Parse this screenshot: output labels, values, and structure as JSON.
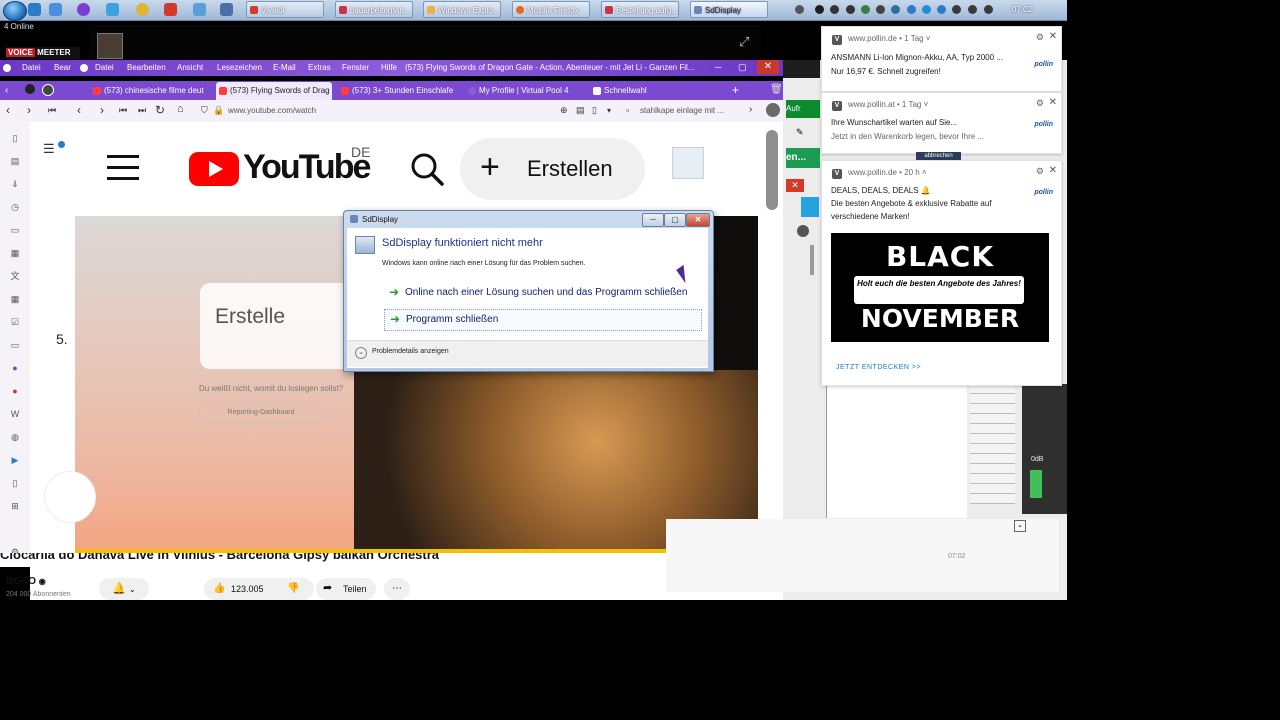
{
  "taskbar": {
    "tasks": [
      {
        "label": "Vivaldi",
        "color": "#d33a2c"
      },
      {
        "label": "bauarbeiterhan...",
        "color": "#c9334b"
      },
      {
        "label": "Windows Explo...",
        "color": "#e8b44a"
      },
      {
        "label": "Mozilla Firefox",
        "color": "#e66a1a"
      },
      {
        "label": "Bestellung aufg...",
        "color": "#c9334b"
      },
      {
        "label": "SdDisplay",
        "color": "#6b87b6"
      }
    ],
    "clock": "07:02"
  },
  "voicemeeter": {
    "online_label": "4 Online",
    "brand_a": "VOICE",
    "brand_b": "MEETER"
  },
  "vivaldi": {
    "menu": [
      "Datei",
      "Bear",
      "Datei",
      "Bearbeiten",
      "Ansicht",
      "Lesezeichen",
      "E-Mail",
      "Extras",
      "Fenster",
      "Hilfe"
    ],
    "window_title": "(573) Flying Swords of Dragon Gate - Action, Abenteuer - mit Jet Li - Ganzen Fil...",
    "tabs": [
      {
        "label": "(573) chinesische filme deut",
        "color": "#ff3b3b"
      },
      {
        "label": "(573) Flying Swords of Drag",
        "color": "#ff3b3b",
        "active": true
      },
      {
        "label": "(573) 3+ Stunden Einschlafe",
        "color": "#ff3b3b"
      },
      {
        "label": "My Profile | Virtual Pool 4",
        "color": "#8a5ad8"
      },
      {
        "label": "Schnellwahl",
        "color": "#ffffff"
      }
    ],
    "url": "www.youtube.com/watch",
    "search_text": "stahlkape einlage mit ..."
  },
  "youtube": {
    "logo_text": "YouTube",
    "country": "DE",
    "create_label": "Erstellen",
    "video_card_text": "Erstelle",
    "video_sub_text": "Du weißt nicht, womit du loslegen sollst?",
    "video_pill": "Reporting-Dashboard",
    "side_number": "5.",
    "video_title": "Ciocarlia do Danava Live in Vilnius - Barcelona Gipsy balkan Orchestra",
    "channel_name": "BGKO",
    "channel_subs": "204 000 Abonnenten",
    "like_count": "123.005",
    "share_label": "Teilen"
  },
  "error_dialog": {
    "title": "SdDisplay",
    "heading": "SdDisplay funktioniert nicht mehr",
    "description": "Windows kann online nach einer Lösung für das Problem suchen.",
    "option1": "Online nach einer Lösung suchen und das Programm schließen",
    "option2": "Programm schließen",
    "details": "Problemdetails anzeigen"
  },
  "right_panel": {
    "green_label": "Aufr",
    "teal_label": "en...",
    "close_glyph": "✕",
    "mixer_db": "0dB",
    "popup_time": "07:02",
    "abbrechen": "abbrechen"
  },
  "notifications": [
    {
      "source": "www.pollin.de • 1 Tag ˅",
      "line1": "ANSMANN Li-Ion Mignon-Akku, AA, Typ 2000 ...",
      "line2": "Nur 16,97 €. Schnell zugreifen!",
      "logo": "pollin"
    },
    {
      "source": "www.pollin.at • 1 Tag ˅",
      "line1": "Ihre Wunschartikel warten auf Sie...",
      "line2": "Jetzt in den Warenkorb legen, bevor Ihre ...",
      "logo": "pollin"
    },
    {
      "source": "www.pollin.de • 20 h ˄",
      "line1": "DEALS, DEALS, DEALS 🔔",
      "line2": "Die besten Angebote & exklusive Rabatte auf",
      "line3": "verschiedene Marken!",
      "logo": "pollin",
      "banner_top": "BLACK",
      "banner_mid": "Holt euch die besten Angebote des Jahres!",
      "banner_bottom": "NOVEMBER",
      "cta": "JETZT ENTDECKEN >>"
    }
  ]
}
